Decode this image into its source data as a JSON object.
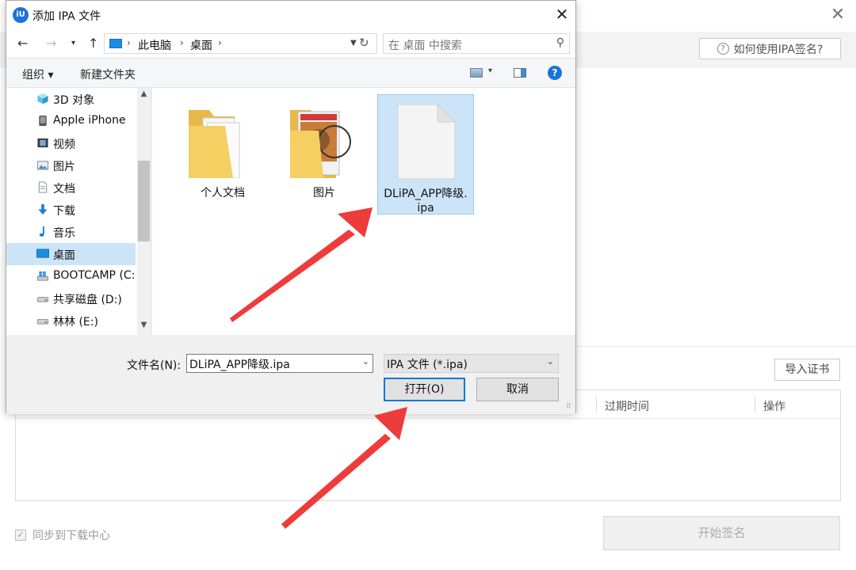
{
  "background_app": {
    "help_label": "如何使用IPA签名?",
    "import_cert_label": "导入证书",
    "table_headers": [
      "过期时间",
      "操作"
    ],
    "sync_label": "同步到下载中心",
    "sign_button_label": "开始签名"
  },
  "dialog": {
    "title": "添加 IPA 文件",
    "app_icon_text": "iU",
    "address": {
      "crumbs": [
        "此电脑",
        "桌面"
      ]
    },
    "search_placeholder": "在 桌面 中搜索",
    "toolbar": {
      "organize": "组织 ▾",
      "new_folder": "新建文件夹"
    },
    "sidebar": {
      "items": [
        {
          "label": "3D 对象",
          "icon": "3d-objects-icon"
        },
        {
          "label": "Apple iPhone",
          "icon": "iphone-icon"
        },
        {
          "label": "视频",
          "icon": "video-icon"
        },
        {
          "label": "图片",
          "icon": "pictures-icon"
        },
        {
          "label": "文档",
          "icon": "documents-icon"
        },
        {
          "label": "下载",
          "icon": "download-icon"
        },
        {
          "label": "音乐",
          "icon": "music-icon"
        },
        {
          "label": "桌面",
          "icon": "desktop-icon",
          "selected": true
        },
        {
          "label": "BOOTCAMP (C:",
          "icon": "windows-drive-icon"
        },
        {
          "label": "共享磁盘 (D:)",
          "icon": "drive-icon"
        },
        {
          "label": "林林 (E:)",
          "icon": "drive-icon"
        }
      ]
    },
    "files": [
      {
        "name": "个人文档",
        "type": "folder"
      },
      {
        "name": "图片",
        "type": "folder-pictures"
      },
      {
        "name_line1": "DLiPA_APP降级.",
        "name_line2": "ipa",
        "type": "file",
        "selected": true
      }
    ],
    "filename_label": "文件名(N):",
    "filename_value": "DLiPA_APP降级.ipa",
    "filetype_value": "IPA 文件 (*.ipa)",
    "open_label": "打开(O)",
    "cancel_label": "取消"
  },
  "colors": {
    "accent": "#0078d7",
    "selection": "#cce4f7",
    "arrow": "#ee3b3b"
  }
}
